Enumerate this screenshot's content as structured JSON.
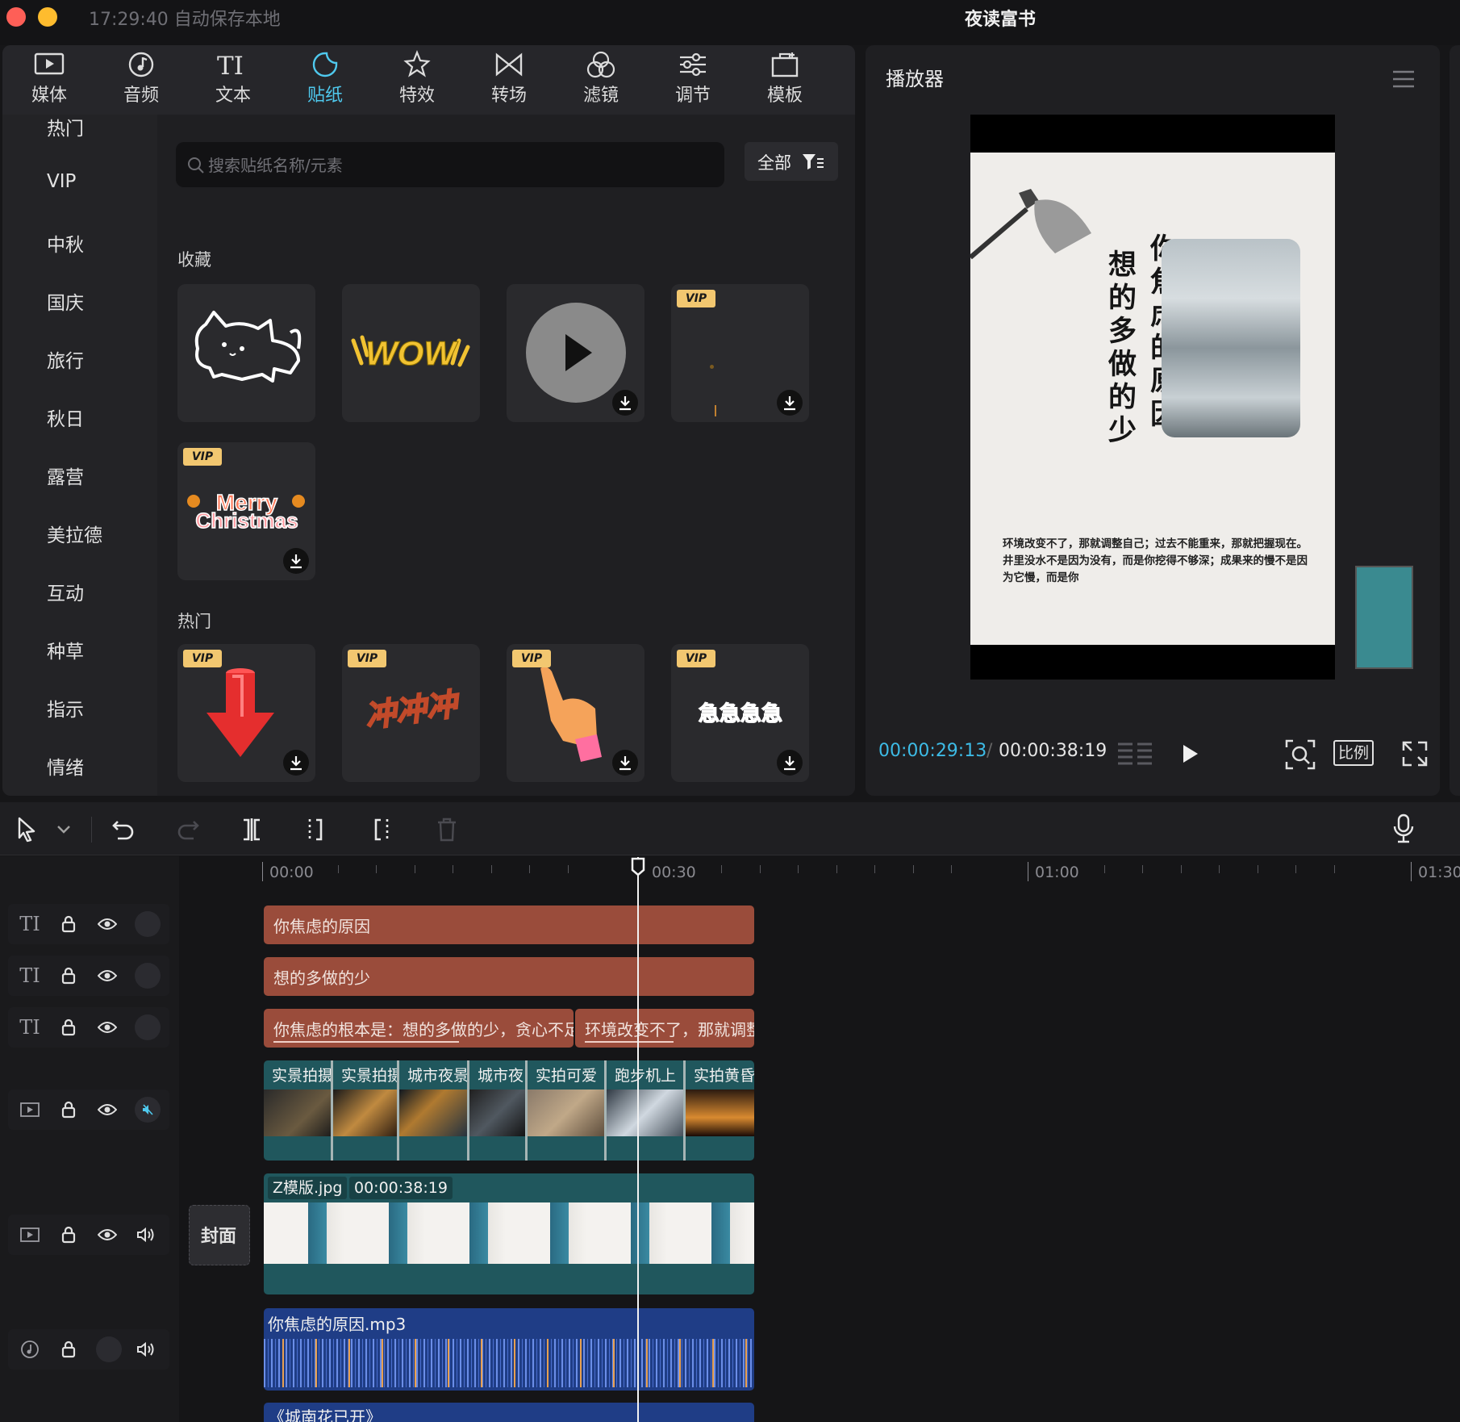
{
  "window": {
    "autosave": "17:29:40 自动保存本地",
    "project_name": "夜读富书"
  },
  "toolbar": [
    {
      "label": "媒体",
      "icon": "media-icon"
    },
    {
      "label": "音频",
      "icon": "audio-icon"
    },
    {
      "label": "文本",
      "icon": "text-icon"
    },
    {
      "label": "贴纸",
      "icon": "sticker-icon",
      "active": true
    },
    {
      "label": "特效",
      "icon": "effects-icon"
    },
    {
      "label": "转场",
      "icon": "transition-icon"
    },
    {
      "label": "滤镜",
      "icon": "filter-icon"
    },
    {
      "label": "调节",
      "icon": "adjust-icon"
    },
    {
      "label": "模板",
      "icon": "template-icon"
    }
  ],
  "categories": [
    "热门",
    "VIP",
    "中秋",
    "国庆",
    "旅行",
    "秋日",
    "露营",
    "美拉德",
    "互动",
    "种草",
    "指示",
    "情绪"
  ],
  "search": {
    "placeholder": "搜索贴纸名称/元素",
    "filter_label": "全部"
  },
  "sections": {
    "favorites": "收藏",
    "hot": "热门",
    "vip_badge": "VIP",
    "sticker_texts": {
      "wow": "WOW",
      "merry": "Merry",
      "christmas": "Christmas",
      "chong": "冲冲冲",
      "ji": "急急急急"
    }
  },
  "player": {
    "title": "播放器",
    "current_time": "00:00:29:13",
    "total_time": "00:00:38:19",
    "ratio_label": "比例",
    "video_text": {
      "line1": "你焦虑的原因",
      "line2": "想的多做的少",
      "paragraph": "环境改变不了，那就调整自己；过去不能重来，那就把握现在。井里没水不是因为没有，而是你挖得不够深；成果来的慢不是因为它慢，而是你"
    }
  },
  "timeline": {
    "ruler": [
      "00:00",
      "00:30",
      "01:00",
      "01:30"
    ],
    "text_track_label": "TI",
    "tracks": {
      "text1": "你焦虑的原因",
      "text2": "想的多做的少",
      "text3a": "你焦虑的根本是：想的多做的少，贪心不足",
      "text3b": "环境改变不了，那就调整",
      "video_segments": [
        "实景拍摄",
        "实景拍摄",
        "城市夜景",
        "城市夜",
        "实拍可爱",
        "跑步机上",
        "实拍黄昏"
      ],
      "template_name": "Z模版.jpg",
      "template_duration": "00:00:38:19",
      "cover_label": "封面",
      "audio1": "你焦虑的原因.mp3",
      "audio2": "《城南花已开》"
    }
  },
  "colors": {
    "accent": "#4fc9ee",
    "text_clip": "#9a4c3b",
    "video_clip": "#20575d",
    "audio_clip": "#1f3d86",
    "vip": "#f2c770"
  }
}
